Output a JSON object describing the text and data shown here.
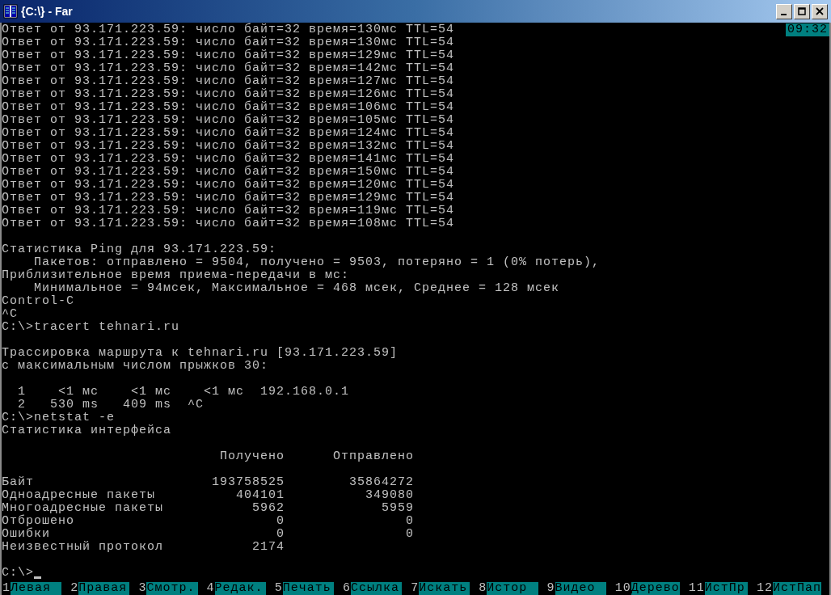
{
  "window": {
    "title": "{C:\\} - Far"
  },
  "clock": "09:32",
  "console_blocks": [
    [
      "Ответ от 93.171.223.59: число байт=32 время=130мс TTL=54",
      "Ответ от 93.171.223.59: число байт=32 время=130мс TTL=54",
      "Ответ от 93.171.223.59: число байт=32 время=129мс TTL=54",
      "Ответ от 93.171.223.59: число байт=32 время=142мс TTL=54",
      "Ответ от 93.171.223.59: число байт=32 время=127мс TTL=54",
      "Ответ от 93.171.223.59: число байт=32 время=126мс TTL=54",
      "Ответ от 93.171.223.59: число байт=32 время=106мс TTL=54",
      "Ответ от 93.171.223.59: число байт=32 время=105мс TTL=54",
      "Ответ от 93.171.223.59: число байт=32 время=124мс TTL=54",
      "Ответ от 93.171.223.59: число байт=32 время=132мс TTL=54",
      "Ответ от 93.171.223.59: число байт=32 время=141мс TTL=54",
      "Ответ от 93.171.223.59: число байт=32 время=150мс TTL=54",
      "Ответ от 93.171.223.59: число байт=32 время=120мс TTL=54",
      "Ответ от 93.171.223.59: число байт=32 время=129мс TTL=54",
      "Ответ от 93.171.223.59: число байт=32 время=119мс TTL=54",
      "Ответ от 93.171.223.59: число байт=32 время=108мс TTL=54"
    ],
    [
      "Статистика Ping для 93.171.223.59:",
      "    Пакетов: отправлено = 9504, получено = 9503, потеряно = 1 (0% потерь),",
      "Приблизительное время приема-передачи в мс:",
      "    Минимальное = 94мсек, Максимальное = 468 мсек, Среднее = 128 мсек",
      "Control-C",
      "^C",
      "C:\\>tracert tehnari.ru"
    ],
    [
      "Трассировка маршрута к tehnari.ru [93.171.223.59]",
      "с максимальным числом прыжков 30:"
    ],
    [
      "  1    <1 мс    <1 мс    <1 мс  192.168.0.1",
      "  2   530 ms   409 ms  ^C",
      "C:\\>netstat -e",
      "Статистика интерфейса"
    ],
    [
      "                           Получено      Отправлено"
    ],
    [
      "Байт                      193758525        35864272",
      "Одноадресные пакеты          404101          349080",
      "Многоадресные пакеты           5962            5959",
      "Отброшено                         0               0",
      "Ошибки                            0               0",
      "Неизвестный протокол           2174"
    ]
  ],
  "prompt": "C:\\>",
  "keybar": [
    {
      "number": "1",
      "label": "Левая"
    },
    {
      "number": "2",
      "label": "Правая"
    },
    {
      "number": "3",
      "label": "Смотр."
    },
    {
      "number": "4",
      "label": "Редак."
    },
    {
      "number": "5",
      "label": "Печать"
    },
    {
      "number": "6",
      "label": "Ссылка"
    },
    {
      "number": "7",
      "label": "Искать"
    },
    {
      "number": "8",
      "label": "Истор"
    },
    {
      "number": "9",
      "label": "Видео"
    },
    {
      "number": "10",
      "label": "Дерево"
    },
    {
      "number": "11",
      "label": "ИстПр"
    },
    {
      "number": "12",
      "label": "ИстПап"
    }
  ]
}
